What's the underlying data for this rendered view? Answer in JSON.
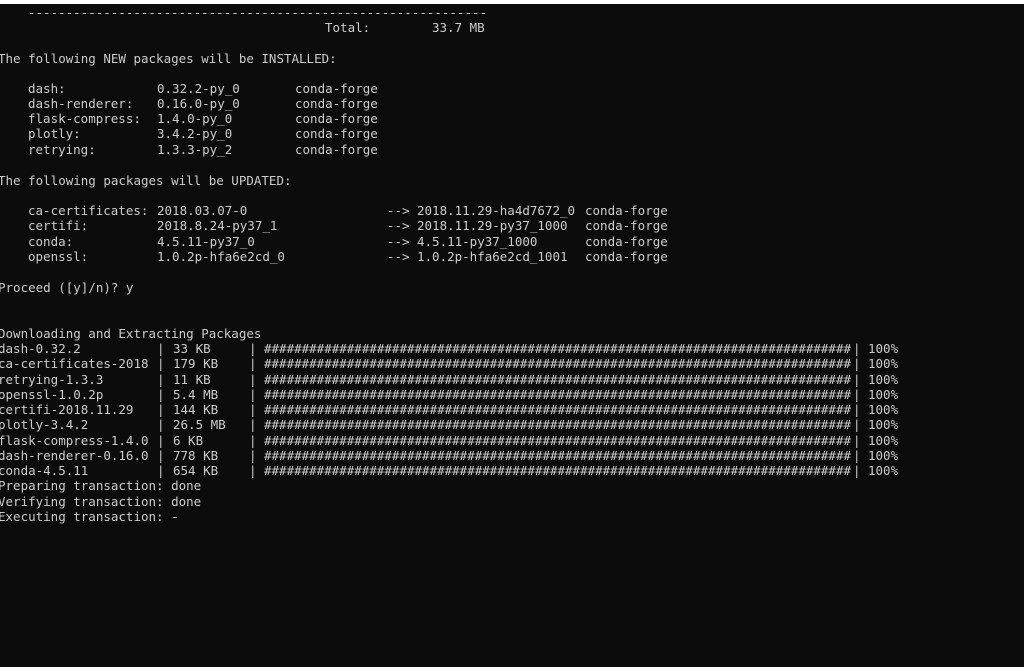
{
  "separator": "-------------------------------------------------------------",
  "total": {
    "label": "Total:",
    "value": "33.7 MB"
  },
  "install_header": "The following NEW packages will be INSTALLED:",
  "install_packages": [
    {
      "name": "dash:",
      "version": "0.32.2-py_0",
      "channel": "conda-forge"
    },
    {
      "name": "dash-renderer:",
      "version": "0.16.0-py_0",
      "channel": "conda-forge"
    },
    {
      "name": "flask-compress:",
      "version": "1.4.0-py_0",
      "channel": "conda-forge"
    },
    {
      "name": "plotly:",
      "version": "3.4.2-py_0",
      "channel": "conda-forge"
    },
    {
      "name": "retrying:",
      "version": "1.3.3-py_2",
      "channel": "conda-forge"
    }
  ],
  "update_header": "The following packages will be UPDATED:",
  "update_packages": [
    {
      "name": "ca-certificates:",
      "from": "2018.03.07-0",
      "arrow": "-->",
      "to": "2018.11.29-ha4d7672_0",
      "channel": "conda-forge"
    },
    {
      "name": "certifi:",
      "from": "2018.8.24-py37_1",
      "arrow": "-->",
      "to": "2018.11.29-py37_1000",
      "channel": "conda-forge"
    },
    {
      "name": "conda:",
      "from": "4.5.11-py37_0",
      "arrow": "-->",
      "to": "4.5.11-py37_1000",
      "channel": "conda-forge"
    },
    {
      "name": "openssl:",
      "from": "1.0.2p-hfa6e2cd_0",
      "arrow": "-->",
      "to": "1.0.2p-hfa6e2cd_1001",
      "channel": "conda-forge"
    }
  ],
  "proceed_prompt": "Proceed ([y]/n)? y",
  "download_header": "Downloading and Extracting Packages",
  "downloads": [
    {
      "name": "dash-0.32.2",
      "size": "33 KB",
      "bar": "##############################################################################",
      "percent": "100%"
    },
    {
      "name": "ca-certificates-2018",
      "size": "179 KB",
      "bar": "##############################################################################",
      "percent": "100%"
    },
    {
      "name": "retrying-1.3.3",
      "size": "11 KB",
      "bar": "##############################################################################",
      "percent": "100%"
    },
    {
      "name": "openssl-1.0.2p",
      "size": "5.4 MB",
      "bar": "##############################################################################",
      "percent": "100%"
    },
    {
      "name": "certifi-2018.11.29",
      "size": "144 KB",
      "bar": "##############################################################################",
      "percent": "100%"
    },
    {
      "name": "plotly-3.4.2",
      "size": "26.5 MB",
      "bar": "##############################################################################",
      "percent": "100%"
    },
    {
      "name": "flask-compress-1.4.0",
      "size": "6 KB",
      "bar": "##############################################################################",
      "percent": "100%"
    },
    {
      "name": "dash-renderer-0.16.0",
      "size": "778 KB",
      "bar": "##############################################################################",
      "percent": "100%"
    },
    {
      "name": "conda-4.5.11",
      "size": "654 KB",
      "bar": "##############################################################################",
      "percent": "100%"
    }
  ],
  "transactions": [
    "Preparing transaction: done",
    "Verifying transaction: done",
    "Executing transaction: -"
  ],
  "colors": {
    "background": "#0c0c0c",
    "text": "#cccccc"
  }
}
